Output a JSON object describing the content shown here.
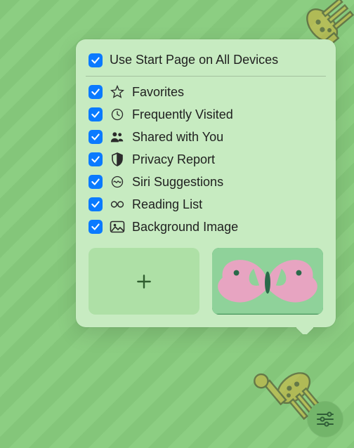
{
  "popover": {
    "header": {
      "label": "Use Start Page on All Devices",
      "checked": true
    },
    "items": [
      {
        "icon": "star-icon",
        "label": "Favorites",
        "checked": true
      },
      {
        "icon": "clock-icon",
        "label": "Frequently Visited",
        "checked": true
      },
      {
        "icon": "people-icon",
        "label": "Shared with You",
        "checked": true
      },
      {
        "icon": "shield-icon",
        "label": "Privacy Report",
        "checked": true
      },
      {
        "icon": "siri-icon",
        "label": "Siri Suggestions",
        "checked": true
      },
      {
        "icon": "glasses-icon",
        "label": "Reading List",
        "checked": true
      },
      {
        "icon": "image-icon",
        "label": "Background Image",
        "checked": true
      }
    ],
    "thumbnails": {
      "add_label": "+",
      "preview_name": "butterfly-wallpaper"
    }
  },
  "settings_button": {
    "name": "customize-start-page"
  },
  "colors": {
    "accent": "#0a7aff",
    "bg": "#88cc7e",
    "popover_bg": "#c7ebc1"
  }
}
